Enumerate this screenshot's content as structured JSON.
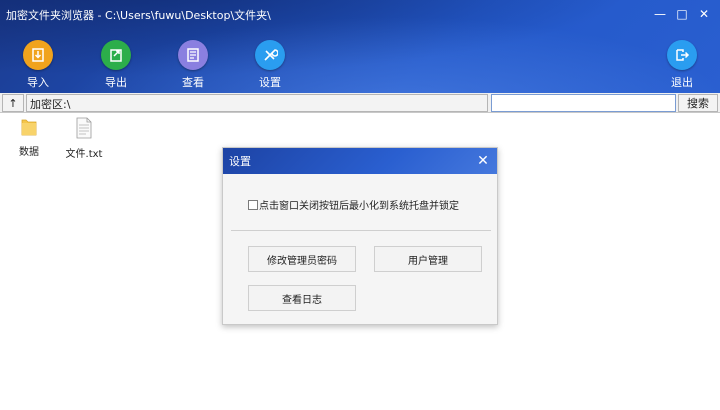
{
  "window": {
    "title": "加密文件夹浏览器 - C:\\Users\\fuwu\\Desktop\\文件夹\\",
    "controls": [
      "—",
      "□",
      "✕"
    ]
  },
  "toolbar": {
    "import_label": "导入",
    "export_label": "导出",
    "view_label": "查看",
    "settings_label": "设置",
    "exit_label": "退出",
    "colors": {
      "import": "#f0a31d",
      "export": "#2cae4a",
      "view": "#8a7fe0",
      "settings": "#2a9df0",
      "exit": "#2a9df0"
    }
  },
  "addressbar": {
    "up_label": "↑",
    "path": "加密区:\\",
    "search_value": "",
    "search_label": "搜索"
  },
  "files": [
    {
      "name": "数据",
      "icon": "folder-icon"
    },
    {
      "name": "文件.txt",
      "icon": "text-file-icon"
    }
  ],
  "dialog": {
    "title": "设置",
    "checkbox_label": "点击窗口关闭按钮后最小化到系统托盘并锁定",
    "checkbox_checked": false,
    "change_password_label": "修改管理员密码",
    "user_management_label": "用户管理",
    "view_log_label": "查看日志"
  }
}
